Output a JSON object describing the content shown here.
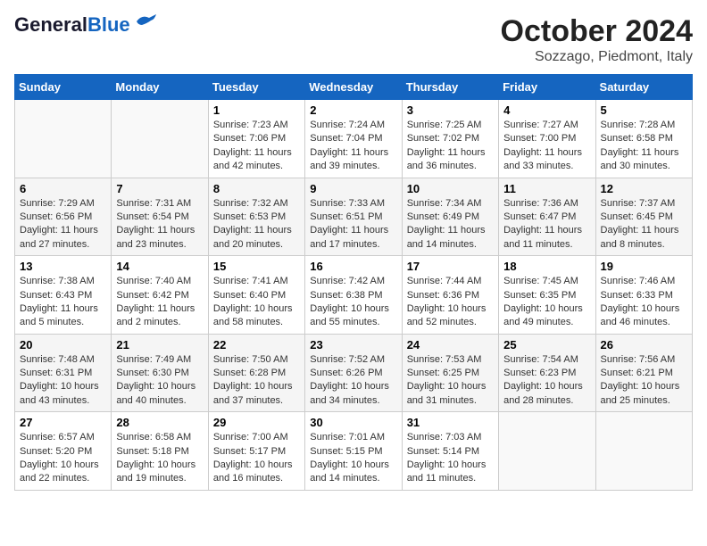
{
  "header": {
    "logo_line1": "General",
    "logo_line2": "Blue",
    "month_title": "October 2024",
    "location": "Sozzago, Piedmont, Italy"
  },
  "days_of_week": [
    "Sunday",
    "Monday",
    "Tuesday",
    "Wednesday",
    "Thursday",
    "Friday",
    "Saturday"
  ],
  "weeks": [
    [
      {
        "num": "",
        "info": ""
      },
      {
        "num": "",
        "info": ""
      },
      {
        "num": "1",
        "info": "Sunrise: 7:23 AM\nSunset: 7:06 PM\nDaylight: 11 hours and 42 minutes."
      },
      {
        "num": "2",
        "info": "Sunrise: 7:24 AM\nSunset: 7:04 PM\nDaylight: 11 hours and 39 minutes."
      },
      {
        "num": "3",
        "info": "Sunrise: 7:25 AM\nSunset: 7:02 PM\nDaylight: 11 hours and 36 minutes."
      },
      {
        "num": "4",
        "info": "Sunrise: 7:27 AM\nSunset: 7:00 PM\nDaylight: 11 hours and 33 minutes."
      },
      {
        "num": "5",
        "info": "Sunrise: 7:28 AM\nSunset: 6:58 PM\nDaylight: 11 hours and 30 minutes."
      }
    ],
    [
      {
        "num": "6",
        "info": "Sunrise: 7:29 AM\nSunset: 6:56 PM\nDaylight: 11 hours and 27 minutes."
      },
      {
        "num": "7",
        "info": "Sunrise: 7:31 AM\nSunset: 6:54 PM\nDaylight: 11 hours and 23 minutes."
      },
      {
        "num": "8",
        "info": "Sunrise: 7:32 AM\nSunset: 6:53 PM\nDaylight: 11 hours and 20 minutes."
      },
      {
        "num": "9",
        "info": "Sunrise: 7:33 AM\nSunset: 6:51 PM\nDaylight: 11 hours and 17 minutes."
      },
      {
        "num": "10",
        "info": "Sunrise: 7:34 AM\nSunset: 6:49 PM\nDaylight: 11 hours and 14 minutes."
      },
      {
        "num": "11",
        "info": "Sunrise: 7:36 AM\nSunset: 6:47 PM\nDaylight: 11 hours and 11 minutes."
      },
      {
        "num": "12",
        "info": "Sunrise: 7:37 AM\nSunset: 6:45 PM\nDaylight: 11 hours and 8 minutes."
      }
    ],
    [
      {
        "num": "13",
        "info": "Sunrise: 7:38 AM\nSunset: 6:43 PM\nDaylight: 11 hours and 5 minutes."
      },
      {
        "num": "14",
        "info": "Sunrise: 7:40 AM\nSunset: 6:42 PM\nDaylight: 11 hours and 2 minutes."
      },
      {
        "num": "15",
        "info": "Sunrise: 7:41 AM\nSunset: 6:40 PM\nDaylight: 10 hours and 58 minutes."
      },
      {
        "num": "16",
        "info": "Sunrise: 7:42 AM\nSunset: 6:38 PM\nDaylight: 10 hours and 55 minutes."
      },
      {
        "num": "17",
        "info": "Sunrise: 7:44 AM\nSunset: 6:36 PM\nDaylight: 10 hours and 52 minutes."
      },
      {
        "num": "18",
        "info": "Sunrise: 7:45 AM\nSunset: 6:35 PM\nDaylight: 10 hours and 49 minutes."
      },
      {
        "num": "19",
        "info": "Sunrise: 7:46 AM\nSunset: 6:33 PM\nDaylight: 10 hours and 46 minutes."
      }
    ],
    [
      {
        "num": "20",
        "info": "Sunrise: 7:48 AM\nSunset: 6:31 PM\nDaylight: 10 hours and 43 minutes."
      },
      {
        "num": "21",
        "info": "Sunrise: 7:49 AM\nSunset: 6:30 PM\nDaylight: 10 hours and 40 minutes."
      },
      {
        "num": "22",
        "info": "Sunrise: 7:50 AM\nSunset: 6:28 PM\nDaylight: 10 hours and 37 minutes."
      },
      {
        "num": "23",
        "info": "Sunrise: 7:52 AM\nSunset: 6:26 PM\nDaylight: 10 hours and 34 minutes."
      },
      {
        "num": "24",
        "info": "Sunrise: 7:53 AM\nSunset: 6:25 PM\nDaylight: 10 hours and 31 minutes."
      },
      {
        "num": "25",
        "info": "Sunrise: 7:54 AM\nSunset: 6:23 PM\nDaylight: 10 hours and 28 minutes."
      },
      {
        "num": "26",
        "info": "Sunrise: 7:56 AM\nSunset: 6:21 PM\nDaylight: 10 hours and 25 minutes."
      }
    ],
    [
      {
        "num": "27",
        "info": "Sunrise: 6:57 AM\nSunset: 5:20 PM\nDaylight: 10 hours and 22 minutes."
      },
      {
        "num": "28",
        "info": "Sunrise: 6:58 AM\nSunset: 5:18 PM\nDaylight: 10 hours and 19 minutes."
      },
      {
        "num": "29",
        "info": "Sunrise: 7:00 AM\nSunset: 5:17 PM\nDaylight: 10 hours and 16 minutes."
      },
      {
        "num": "30",
        "info": "Sunrise: 7:01 AM\nSunset: 5:15 PM\nDaylight: 10 hours and 14 minutes."
      },
      {
        "num": "31",
        "info": "Sunrise: 7:03 AM\nSunset: 5:14 PM\nDaylight: 10 hours and 11 minutes."
      },
      {
        "num": "",
        "info": ""
      },
      {
        "num": "",
        "info": ""
      }
    ]
  ]
}
